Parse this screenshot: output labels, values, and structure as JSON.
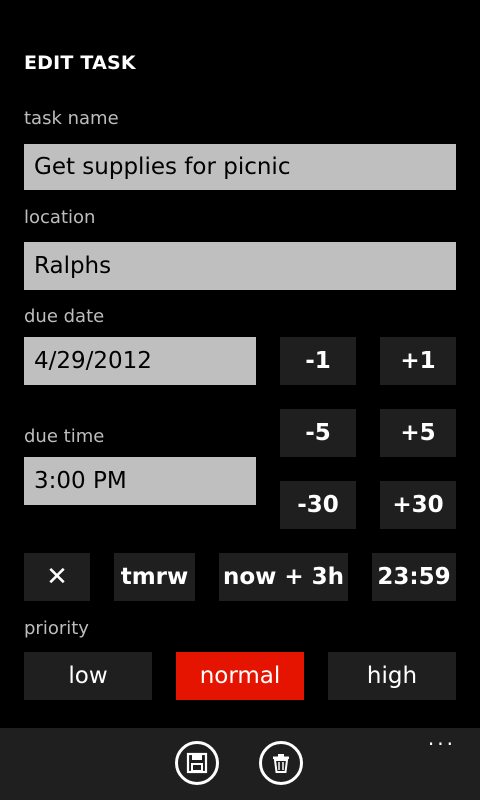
{
  "header": {
    "title": "EDIT TASK"
  },
  "task_name": {
    "label": "task name",
    "value": "Get supplies for picnic"
  },
  "location": {
    "label": "location",
    "value": "Ralphs"
  },
  "due_date": {
    "label": "due date",
    "value": "4/29/2012",
    "minus1": "-1",
    "plus1": "+1"
  },
  "due_time": {
    "label": "due time",
    "value": "3:00 PM",
    "minus5": "-5",
    "plus5": "+5",
    "minus30": "-30",
    "plus30": "+30"
  },
  "quick": {
    "clear": "✕",
    "tomorrow": "tmrw",
    "now_plus_3h": "now + 3h",
    "end_of_day": "23:59"
  },
  "priority": {
    "label": "priority",
    "options": [
      "low",
      "normal",
      "high"
    ],
    "selected": "normal",
    "accent": "#e51400"
  },
  "appbar": {
    "buttons": [
      {
        "icon": "save-icon"
      },
      {
        "icon": "delete-icon"
      }
    ],
    "more": "..."
  }
}
